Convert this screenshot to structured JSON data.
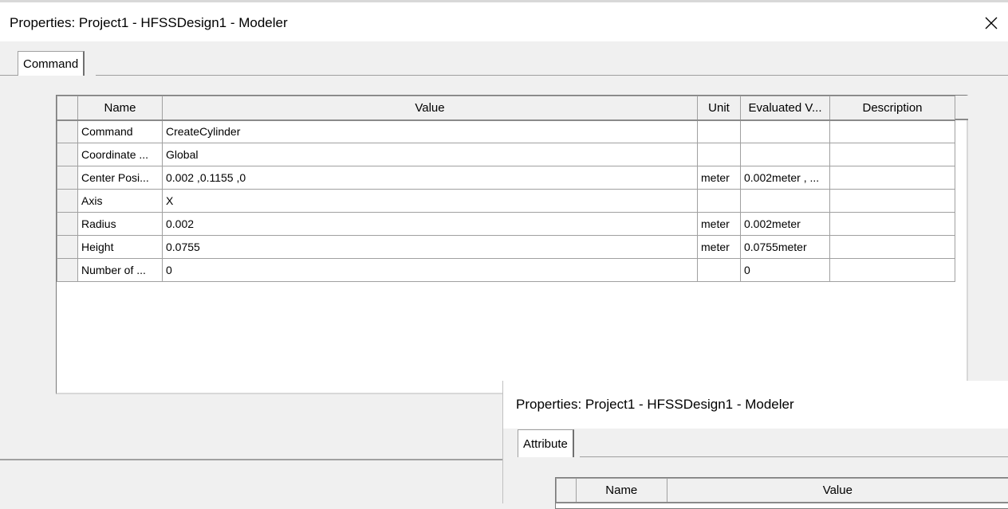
{
  "main_dialog": {
    "title": "Properties: Project1 - HFSSDesign1 - Modeler",
    "tab_label": "Command",
    "columns": [
      "Name",
      "Value",
      "Unit",
      "Evaluated V...",
      "Description"
    ],
    "rows": [
      {
        "name": "Command",
        "value": "CreateCylinder",
        "unit": "",
        "evaluated": "",
        "description": ""
      },
      {
        "name": "Coordinate ...",
        "value": "Global",
        "unit": "",
        "evaluated": "",
        "description": ""
      },
      {
        "name": "Center Posi...",
        "value": "0.002 ,0.1155 ,0",
        "unit": "meter",
        "evaluated": "0.002meter , ...",
        "description": ""
      },
      {
        "name": "Axis",
        "value": "X",
        "unit": "",
        "evaluated": "",
        "description": ""
      },
      {
        "name": "Radius",
        "value": "0.002",
        "unit": "meter",
        "evaluated": "0.002meter",
        "description": ""
      },
      {
        "name": "Height",
        "value": "0.0755",
        "unit": "meter",
        "evaluated": "0.0755meter",
        "description": ""
      },
      {
        "name": "Number of ...",
        "value": "0",
        "unit": "",
        "evaluated": "0",
        "description": ""
      }
    ]
  },
  "second_dialog": {
    "title": "Properties: Project1 - HFSSDesign1 - Modeler",
    "tab_label": "Attribute",
    "columns": [
      "Name",
      "Value"
    ]
  },
  "icons": {
    "close": "close-icon"
  }
}
